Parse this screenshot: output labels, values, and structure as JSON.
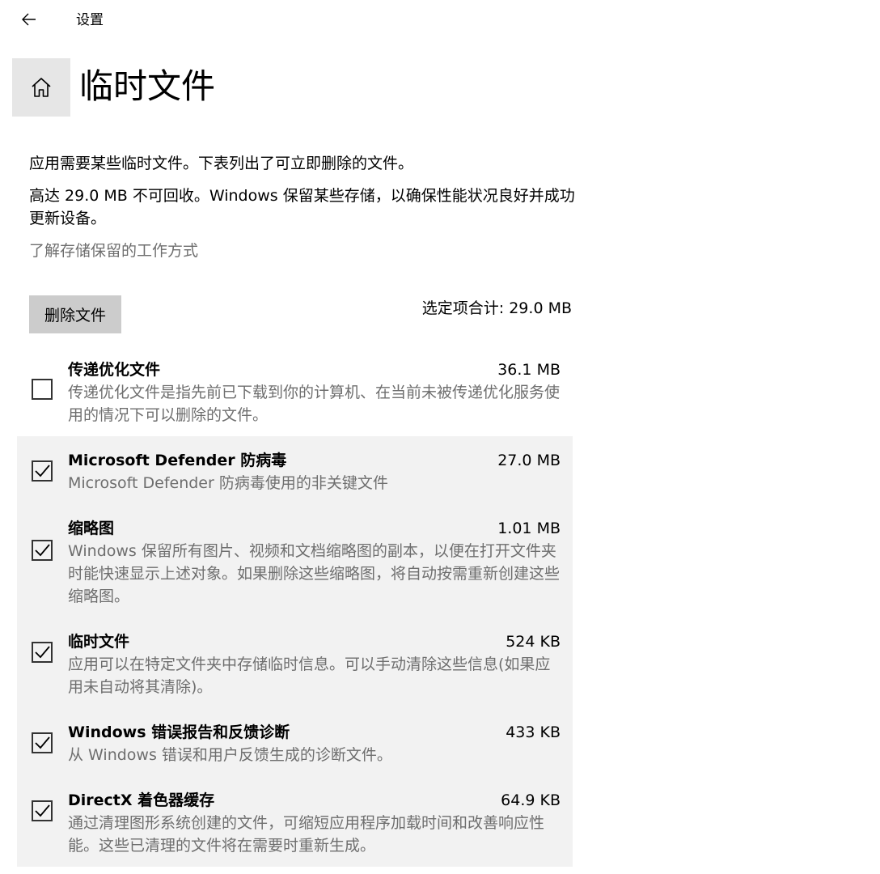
{
  "window": {
    "title": "设置"
  },
  "header": {
    "title": "临时文件"
  },
  "description": {
    "line1": "应用需要某些临时文件。下表列出了可立即删除的文件。",
    "line2": "高达 29.0 MB 不可回收。Windows 保留某些存储，以确保性能状况良好并成功更新设备。",
    "learn_more": "了解存储保留的工作方式"
  },
  "actions": {
    "delete_label": "删除文件",
    "total_selected": "选定项合计: 29.0 MB"
  },
  "items": [
    {
      "name": "传递优化文件",
      "size": "36.1 MB",
      "description": "传递优化文件是指先前已下载到你的计算机、在当前未被传递优化服务使用的情况下可以删除的文件。",
      "checked": false
    },
    {
      "name": "Microsoft Defender 防病毒",
      "size": "27.0 MB",
      "description": "Microsoft Defender 防病毒使用的非关键文件",
      "checked": true
    },
    {
      "name": "缩略图",
      "size": "1.01 MB",
      "description": "Windows 保留所有图片、视频和文档缩略图的副本，以便在打开文件夹时能快速显示上述对象。如果删除这些缩略图，将自动按需重新创建这些缩略图。",
      "checked": true
    },
    {
      "name": "临时文件",
      "size": "524 KB",
      "description": "应用可以在特定文件夹中存储临时信息。可以手动清除这些信息(如果应用未自动将其清除)。",
      "checked": true
    },
    {
      "name": "Windows 错误报告和反馈诊断",
      "size": "433 KB",
      "description": "从 Windows 错误和用户反馈生成的诊断文件。",
      "checked": true
    },
    {
      "name": "DirectX 着色器缓存",
      "size": "64.9 KB",
      "description": "通过清理图形系统创建的文件，可缩短应用程序加载时间和改善响应性能。这些已清理的文件将在需要时重新生成。",
      "checked": true
    }
  ],
  "icons": {
    "back": "back-arrow-icon",
    "home": "home-icon",
    "check": "checkmark-icon"
  },
  "colors": {
    "selected_row_bg": "#f2f2f2",
    "secondary_text": "#6e6e6e",
    "button_bg": "#cccccc",
    "home_bg": "#e6e6e6"
  }
}
